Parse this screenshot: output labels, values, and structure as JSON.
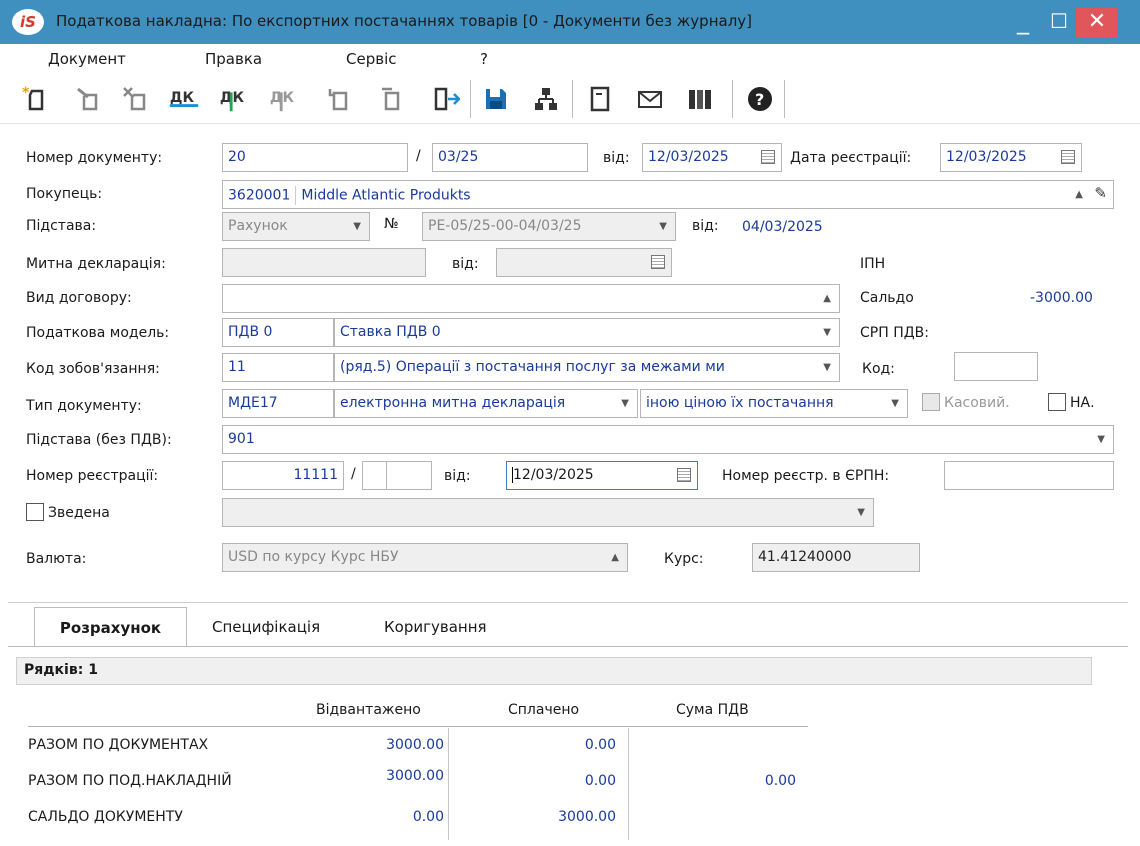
{
  "window": {
    "app_icon": "iS",
    "title": "Податкова накладна: По експортних  постачаннях товарів [0 - Документи без журналу]",
    "min": "_",
    "max": "☐",
    "close": "✕"
  },
  "menu": [
    "Документ",
    "Правка",
    "Сервіс",
    "?"
  ],
  "toolbar": {
    "icons": [
      "new-doc-icon",
      "edit-doc-icon",
      "delete-doc-icon",
      "dk-icon",
      "dk-up-icon",
      "dk-down-icon",
      "copy-doc-icon",
      "copy-doc2-icon",
      "exit-icon",
      "save-icon",
      "hierarchy-icon",
      "form-icon",
      "mail-icon",
      "library-icon",
      "help-icon"
    ]
  },
  "form": {
    "doc_number_label": "Номер документу:",
    "doc_number": "20",
    "slash": "/",
    "doc_number_suffix": "03/25",
    "from_label": "від:",
    "doc_date": "12/03/2025",
    "reg_date_label": "Дата реєстрації:",
    "reg_date": "12/03/2025",
    "buyer_label": "Покупець:",
    "buyer_code": "3620001",
    "buyer_name": "Middle Atlantic Produkts",
    "basis_label": "Підстава:",
    "basis_type": "Рахунок",
    "num_sign": "№",
    "basis_number": "РЕ-05/25-00-04/03/25",
    "basis_from_label": "від:",
    "basis_date": "04/03/2025",
    "customs_label": "Митна декларація:",
    "customs_from_label": "від:",
    "ipn_label": "ІПН",
    "contract_label": "Вид договору:",
    "saldo_label": "Сальдо",
    "saldo_value": "-3000.00",
    "tax_model_label": "Податкова модель:",
    "tax_model_code": "ПДВ  0",
    "tax_model_name": "Ставка ПДВ 0",
    "srp_label": "СРП ПДВ:",
    "obligation_label": "Код зобов'язання:",
    "obligation_code": "11",
    "obligation_name": "(ряд.5) Операції з постачання послуг за межами ми",
    "code_label": "Код:",
    "doc_type_label": "Тип документу:",
    "doc_type_code": "МДЕ17",
    "doc_type_name": "електронна митна декларація",
    "doc_type_extra": "іною ціною їх постачання",
    "cash_label": "Касовий.",
    "na_label": "НА.",
    "basis_novat_label": "Підстава (без ПДВ):",
    "basis_novat": "901",
    "reg_number_label": "Номер реєстрації:",
    "reg_number": "11111",
    "reg_slash": "/",
    "reg_from_label": "від:",
    "reg_from_date": "12/03/2025",
    "erpn_label": "Номер реєстр. в ЄРПН:",
    "consolidated_label": "Зведена",
    "currency_label": "Валюта:",
    "currency": "USD по курсу Курс НБУ",
    "rate_label": "Курс:",
    "rate": "41.41240000"
  },
  "tabs": [
    "Розрахунок",
    "Специфікація",
    "Коригування"
  ],
  "table": {
    "rows_label": "Рядків: 1",
    "headers": [
      "Відвантажено",
      "Сплачено",
      "Сума ПДВ"
    ],
    "rows": [
      {
        "label": "РАЗОМ ПО ДОКУМЕНТАХ",
        "shipped": "3000.00",
        "paid": "0.00",
        "vat": ""
      },
      {
        "label": "РАЗОМ ПО ПОД.НАКЛАДНІЙ",
        "shipped": "3000.00",
        "paid": "0.00",
        "vat": "0.00"
      },
      {
        "label": "САЛЬДО ДОКУМЕНТУ",
        "shipped": "0.00",
        "paid": "3000.00",
        "vat": ""
      }
    ]
  }
}
